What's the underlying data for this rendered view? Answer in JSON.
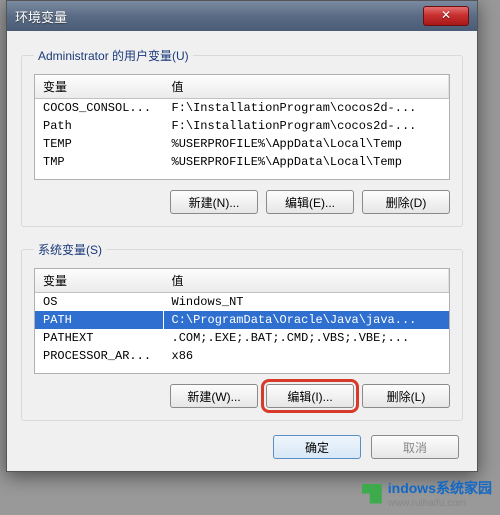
{
  "title": "环境变量",
  "close_glyph": "✕",
  "user_group": {
    "legend": "Administrator 的用户变量(U)",
    "headers": {
      "var": "变量",
      "val": "值"
    },
    "rows": [
      {
        "var": "COCOS_CONSOL...",
        "val": "F:\\InstallationProgram\\cocos2d-..."
      },
      {
        "var": "Path",
        "val": "F:\\InstallationProgram\\cocos2d-..."
      },
      {
        "var": "TEMP",
        "val": "%USERPROFILE%\\AppData\\Local\\Temp"
      },
      {
        "var": "TMP",
        "val": "%USERPROFILE%\\AppData\\Local\\Temp"
      }
    ],
    "buttons": {
      "new": "新建(N)...",
      "edit": "编辑(E)...",
      "del": "删除(D)"
    }
  },
  "sys_group": {
    "legend": "系统变量(S)",
    "headers": {
      "var": "变量",
      "val": "值"
    },
    "rows": [
      {
        "var": "OS",
        "val": "Windows_NT",
        "selected": false
      },
      {
        "var": "PATH",
        "val": "C:\\ProgramData\\Oracle\\Java\\java...",
        "selected": true
      },
      {
        "var": "PATHEXT",
        "val": ".COM;.EXE;.BAT;.CMD;.VBS;.VBE;...",
        "selected": false
      },
      {
        "var": "PROCESSOR_AR...",
        "val": "x86",
        "selected": false
      }
    ],
    "buttons": {
      "new": "新建(W)...",
      "edit": "编辑(I)...",
      "del": "删除(L)"
    }
  },
  "footer": {
    "ok": "确定",
    "cancel": "取消"
  },
  "watermark": {
    "brand": "indows系统家园",
    "url": "www.ruihaifu.com"
  }
}
